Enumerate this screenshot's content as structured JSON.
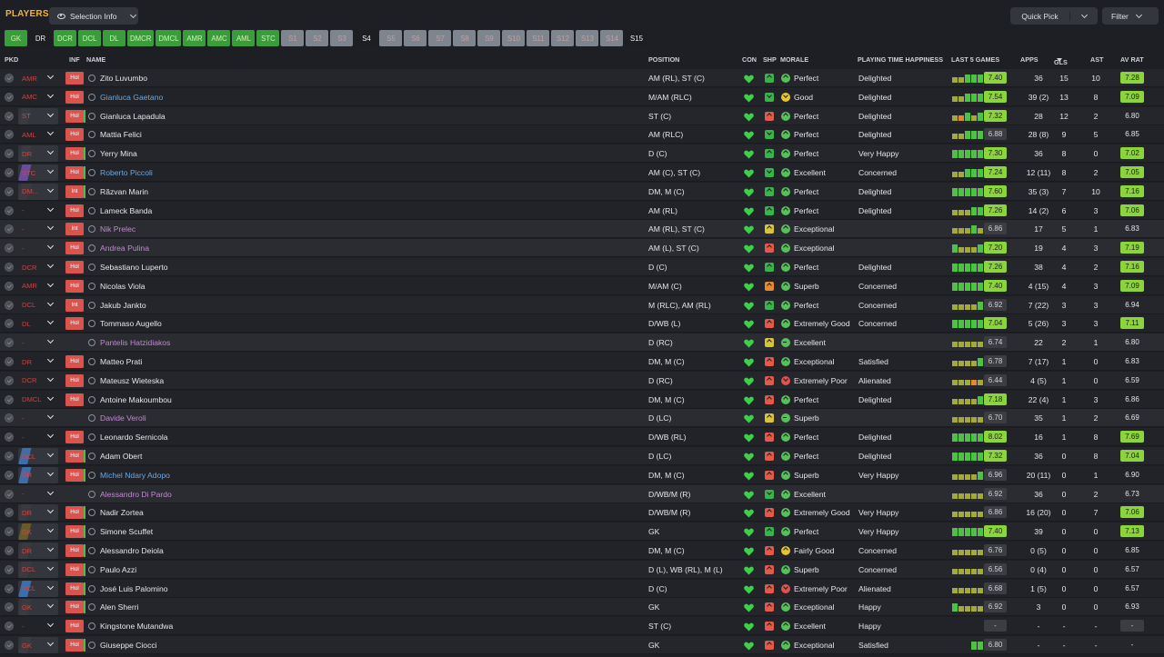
{
  "header": {
    "title": "PLAYERS",
    "selection_label": "Selection Info",
    "quickpick_label": "Quick Pick",
    "filter_label": "Filter"
  },
  "positions": [
    {
      "label": "GK",
      "style": "g"
    },
    {
      "label": "DR",
      "style": "k"
    },
    {
      "label": "DCR",
      "style": "g"
    },
    {
      "label": "DCL",
      "style": "g"
    },
    {
      "label": "DL",
      "style": "g"
    },
    {
      "label": "DMCR",
      "style": "g"
    },
    {
      "label": "DMCL",
      "style": "g"
    },
    {
      "label": "AMR",
      "style": "g"
    },
    {
      "label": "AMC",
      "style": "g"
    },
    {
      "label": "AML",
      "style": "g"
    },
    {
      "label": "STC",
      "style": "g"
    },
    {
      "label": "S1",
      "style": "s"
    },
    {
      "label": "S2",
      "style": "s"
    },
    {
      "label": "S3",
      "style": "s"
    },
    {
      "label": "S4",
      "style": "sel"
    },
    {
      "label": "S5",
      "style": "s"
    },
    {
      "label": "S6",
      "style": "s"
    },
    {
      "label": "S7",
      "style": "s"
    },
    {
      "label": "S8",
      "style": "s"
    },
    {
      "label": "S9",
      "style": "s"
    },
    {
      "label": "S10",
      "style": "s"
    },
    {
      "label": "S11",
      "style": "s"
    },
    {
      "label": "S12",
      "style": "s"
    },
    {
      "label": "S13",
      "style": "s"
    },
    {
      "label": "S14",
      "style": "s"
    },
    {
      "label": "S15",
      "style": "sel"
    }
  ],
  "columns": {
    "pkd": "PKD",
    "inf": "INF",
    "name": "NAME",
    "position": "POSITION",
    "con": "CON",
    "shp": "SHP",
    "morale": "MORALE",
    "pth": "PLAYING TIME HAPPINESS",
    "last5": "LAST 5 GAMES",
    "apps": "APPS",
    "gls": "GLS",
    "ast": "AST",
    "avrat": "AV RAT"
  },
  "colors": {
    "accent_title": "#f2b331",
    "green": "#8bd43b",
    "red_inf": "#d9534f",
    "link_name": "#6aa8e4",
    "loan_name": "#c288d3"
  },
  "players": [
    {
      "pos": "AMR",
      "pc": "",
      "inf": "Hol",
      "name": "Zito Luvumbo",
      "nt": "",
      "position": "AM (RL), ST (C)",
      "shp": "u",
      "mi": "up",
      "mc": "#55c15a",
      "morale": "Perfect",
      "pth": "Delighted",
      "form": "yyggg",
      "l5": "7.40",
      "l5g": true,
      "apps": "36",
      "gls": "15",
      "ast": "10",
      "av": "7.28",
      "av_s": "g"
    },
    {
      "pos": "AMC",
      "pc": "",
      "inf": "Hol",
      "name": "Gianluca Gaetano",
      "nt": "link",
      "position": "M/AM (RLC)",
      "shp": "d",
      "mi": "dn",
      "mc": "#e6c62f",
      "morale": "Good",
      "pth": "Delighted",
      "form": "yyggg",
      "l5": "7.54",
      "l5g": true,
      "apps": "39 (2)",
      "gls": "13",
      "ast": "8",
      "av": "7.09",
      "av_s": "g"
    },
    {
      "pos": "ST",
      "pc": "#3a3b40",
      "inf": "Hol",
      "name": "Gianluca Lapadula",
      "nt": "",
      "position": "ST (C)",
      "shp": "r",
      "mi": "up",
      "mc": "#55c15a",
      "morale": "Perfect",
      "pth": "Delighted",
      "form": "yogyg",
      "l5": "7.32",
      "l5g": true,
      "apps": "28",
      "gls": "12",
      "ast": "2",
      "av": "6.80",
      "av_s": "p"
    },
    {
      "pos": "AML",
      "pc": "",
      "inf": "Hol",
      "name": "Mattia Felici",
      "nt": "",
      "position": "AM (RLC)",
      "shp": "d",
      "mi": "up",
      "mc": "#55c15a",
      "morale": "Perfect",
      "pth": "Delighted",
      "form": "yyggg",
      "l5": "6.88",
      "l5g": false,
      "apps": "28 (8)",
      "gls": "9",
      "ast": "5",
      "av": "6.85",
      "av_s": "p"
    },
    {
      "pos": "DR",
      "pc": "#3a3b40",
      "inf": "Hol",
      "name": "Yerry Mina",
      "nt": "",
      "position": "D (C)",
      "shp": "u",
      "mi": "up",
      "mc": "#55c15a",
      "morale": "Perfect",
      "pth": "Very Happy",
      "form": "ggggg",
      "l5": "7.30",
      "l5g": true,
      "apps": "36",
      "gls": "8",
      "ast": "0",
      "av": "7.02",
      "av_s": "g"
    },
    {
      "pos": "STC",
      "pc": "#6a4c9c",
      "inf": "Hol",
      "name": "Roberto Piccoli",
      "nt": "link",
      "position": "AM (C), ST (C)",
      "shp": "d",
      "mi": "up",
      "mc": "#55c15a",
      "morale": "Excellent",
      "pth": "Concerned",
      "form": "yyggg",
      "l5": "7.24",
      "l5g": true,
      "apps": "12 (11)",
      "gls": "8",
      "ast": "2",
      "av": "7.05",
      "av_s": "g"
    },
    {
      "pos": "DM...",
      "pc": "#3a3b40",
      "inf": "Int",
      "name": "Răzvan Marin",
      "nt": "",
      "position": "DM, M (C)",
      "shp": "u",
      "mi": "up",
      "mc": "#55c15a",
      "morale": "Perfect",
      "pth": "Delighted",
      "form": "ggggg",
      "l5": "7.60",
      "l5g": true,
      "apps": "35 (3)",
      "gls": "7",
      "ast": "10",
      "av": "7.16",
      "av_s": "g"
    },
    {
      "pos": "-",
      "pc": "",
      "inf": "Hol",
      "name": "Lameck Banda",
      "nt": "",
      "position": "AM (RL)",
      "shp": "u",
      "mi": "up",
      "mc": "#55c15a",
      "morale": "Perfect",
      "pth": "Delighted",
      "form": "yyygg",
      "l5": "7.26",
      "l5g": true,
      "apps": "14 (2)",
      "gls": "6",
      "ast": "3",
      "av": "7.06",
      "av_s": "g"
    },
    {
      "pos": "-",
      "pc": "",
      "inf": "Int",
      "name": "Nik Prelec",
      "nt": "loan",
      "position": "AM (RL), ST (C)",
      "shp": "m",
      "mi": "up",
      "mc": "#55c15a",
      "morale": "Exceptional",
      "pth": "",
      "form": "yyygy",
      "l5": "6.86",
      "l5g": false,
      "apps": "17",
      "gls": "5",
      "ast": "1",
      "av": "6.83",
      "av_s": "p"
    },
    {
      "pos": "-",
      "pc": "",
      "inf": "Hol",
      "name": "Andrea Pulina",
      "nt": "loan",
      "position": "AM (L), ST (C)",
      "shp": "r",
      "mi": "up",
      "mc": "#55c15a",
      "morale": "Exceptional",
      "pth": "",
      "form": "gyyyg",
      "l5": "7.20",
      "l5g": true,
      "apps": "19",
      "gls": "4",
      "ast": "3",
      "av": "7.19",
      "av_s": "g"
    },
    {
      "pos": "DCR",
      "pc": "",
      "inf": "Hol",
      "name": "Sebastiano Luperto",
      "nt": "",
      "position": "D (C)",
      "shp": "u",
      "mi": "up",
      "mc": "#55c15a",
      "morale": "Perfect",
      "pth": "Delighted",
      "form": "ggggg",
      "l5": "7.26",
      "l5g": true,
      "apps": "38",
      "gls": "4",
      "ast": "2",
      "av": "7.16",
      "av_s": "g"
    },
    {
      "pos": "AMR",
      "pc": "",
      "inf": "Hol",
      "name": "Nicolas Viola",
      "nt": "",
      "position": "M/AM (C)",
      "shp": "o",
      "mi": "up",
      "mc": "#55c15a",
      "morale": "Superb",
      "pth": "Concerned",
      "form": "ggggg",
      "l5": "7.40",
      "l5g": true,
      "apps": "4 (15)",
      "gls": "4",
      "ast": "3",
      "av": "7.09",
      "av_s": "g"
    },
    {
      "pos": "DCL",
      "pc": "",
      "inf": "Int",
      "name": "Jakub Jankto",
      "nt": "",
      "position": "M (RLC), AM (RL)",
      "shp": "u",
      "mi": "up",
      "mc": "#55c15a",
      "morale": "Perfect",
      "pth": "Concerned",
      "form": "yyyyg",
      "l5": "6.92",
      "l5g": false,
      "apps": "7 (22)",
      "gls": "3",
      "ast": "3",
      "av": "6.94",
      "av_s": "p"
    },
    {
      "pos": "DL",
      "pc": "",
      "inf": "Hol",
      "name": "Tommaso Augello",
      "nt": "",
      "position": "D/WB (L)",
      "shp": "r",
      "mi": "up",
      "mc": "#55c15a",
      "morale": "Extremely Good",
      "pth": "Concerned",
      "form": "ggggg",
      "l5": "7.04",
      "l5g": true,
      "apps": "5 (26)",
      "gls": "3",
      "ast": "3",
      "av": "7.11",
      "av_s": "g"
    },
    {
      "pos": "-",
      "pc": "",
      "inf": "",
      "name": "Pantelis Hatzidiakos",
      "nt": "loan",
      "position": "D (RC)",
      "shp": "m",
      "mi": "mid",
      "mc": "#55c15a",
      "morale": "Excellent",
      "pth": "",
      "form": "yyyyy",
      "l5": "6.74",
      "l5g": false,
      "apps": "22",
      "gls": "2",
      "ast": "1",
      "av": "6.80",
      "av_s": "p"
    },
    {
      "pos": "DR",
      "pc": "",
      "inf": "Hol",
      "name": "Matteo Prati",
      "nt": "",
      "position": "DM, M (C)",
      "shp": "r",
      "mi": "up",
      "mc": "#55c15a",
      "morale": "Exceptional",
      "pth": "Satisfied",
      "form": "yyyyg",
      "l5": "6.78",
      "l5g": false,
      "apps": "7 (17)",
      "gls": "1",
      "ast": "0",
      "av": "6.83",
      "av_s": "p"
    },
    {
      "pos": "DCR",
      "pc": "",
      "inf": "Hol",
      "name": "Mateusz Wieteska",
      "nt": "",
      "position": "D (RC)",
      "shp": "r",
      "mi": "dn",
      "mc": "#e05252",
      "morale": "Extremely Poor",
      "pth": "Alienated",
      "form": "yyyoy",
      "l5": "6.44",
      "l5g": false,
      "apps": "4 (5)",
      "gls": "1",
      "ast": "0",
      "av": "6.59",
      "av_s": "p"
    },
    {
      "pos": "DMCL",
      "pc": "",
      "inf": "Hol",
      "name": "Antoine Makoumbou",
      "nt": "",
      "position": "DM, M (C)",
      "shp": "r",
      "mi": "up",
      "mc": "#55c15a",
      "morale": "Perfect",
      "pth": "Delighted",
      "form": "yyyyg",
      "l5": "7.18",
      "l5g": true,
      "apps": "22 (4)",
      "gls": "1",
      "ast": "3",
      "av": "6.86",
      "av_s": "p"
    },
    {
      "pos": "-",
      "pc": "",
      "inf": "",
      "name": "Davide Veroli",
      "nt": "loan",
      "position": "D (LC)",
      "shp": "m",
      "mi": "mid",
      "mc": "#55c15a",
      "morale": "Superb",
      "pth": "",
      "form": "yyyyy",
      "l5": "6.70",
      "l5g": false,
      "apps": "35",
      "gls": "1",
      "ast": "2",
      "av": "6.69",
      "av_s": "p"
    },
    {
      "pos": "-",
      "pc": "",
      "inf": "Hol",
      "name": "Leonardo Sernicola",
      "nt": "",
      "position": "D/WB (RL)",
      "shp": "r",
      "mi": "up",
      "mc": "#55c15a",
      "morale": "Perfect",
      "pth": "Delighted",
      "form": "ggggg",
      "l5": "8.02",
      "l5g": true,
      "apps": "16",
      "gls": "1",
      "ast": "8",
      "av": "7.69",
      "av_s": "g"
    },
    {
      "pos": "DCL",
      "pc": "#3c6eae",
      "inf": "Hol",
      "name": "Adam Obert",
      "nt": "",
      "position": "D (LC)",
      "shp": "r",
      "mi": "up",
      "mc": "#55c15a",
      "morale": "Perfect",
      "pth": "Delighted",
      "form": "ggggg",
      "l5": "7.32",
      "l5g": true,
      "apps": "36",
      "gls": "0",
      "ast": "8",
      "av": "7.04",
      "av_s": "g"
    },
    {
      "pos": "DR",
      "pc": "#3c6eae",
      "inf": "Hol",
      "name": "Michel Ndary Adopo",
      "nt": "link",
      "position": "DM, M (C)",
      "shp": "r",
      "mi": "up",
      "mc": "#55c15a",
      "morale": "Superb",
      "pth": "Very Happy",
      "form": "yyyyg",
      "l5": "6.96",
      "l5g": false,
      "apps": "20 (11)",
      "gls": "0",
      "ast": "1",
      "av": "6.90",
      "av_s": "p"
    },
    {
      "pos": "-",
      "pc": "",
      "inf": "",
      "name": "Alessandro Di Pardo",
      "nt": "loan",
      "position": "D/WB/M (R)",
      "shp": "d",
      "mi": "up",
      "mc": "#55c15a",
      "morale": "Excellent",
      "pth": "",
      "form": "yyyyy",
      "l5": "6.92",
      "l5g": false,
      "apps": "36",
      "gls": "0",
      "ast": "2",
      "av": "6.73",
      "av_s": "p"
    },
    {
      "pos": "DR",
      "pc": "#3a3b40",
      "inf": "Hol",
      "name": "Nadir Zortea",
      "nt": "",
      "position": "D/WB/M (R)",
      "shp": "r",
      "mi": "up",
      "mc": "#55c15a",
      "morale": "Extremely Good",
      "pth": "Very Happy",
      "form": "yyyyy",
      "l5": "6.86",
      "l5g": false,
      "apps": "16 (20)",
      "gls": "0",
      "ast": "7",
      "av": "7.06",
      "av_s": "g"
    },
    {
      "pos": "GK",
      "pc": "#6a5a2a",
      "inf": "Hol",
      "name": "Simone Scuffet",
      "nt": "",
      "position": "GK",
      "shp": "u",
      "mi": "up",
      "mc": "#55c15a",
      "morale": "Perfect",
      "pth": "Very Happy",
      "form": "ggggg",
      "l5": "7.40",
      "l5g": true,
      "apps": "39",
      "gls": "0",
      "ast": "0",
      "av": "7.13",
      "av_s": "g"
    },
    {
      "pos": "DR",
      "pc": "#3a3b40",
      "inf": "Hol",
      "name": "Alessandro Deiola",
      "nt": "",
      "position": "DM, M (C)",
      "shp": "r",
      "mi": "up",
      "mc": "#e6c62f",
      "morale": "Fairly Good",
      "pth": "Concerned",
      "form": "yyyyy",
      "l5": "6.76",
      "l5g": false,
      "apps": "0 (5)",
      "gls": "0",
      "ast": "0",
      "av": "6.85",
      "av_s": "p"
    },
    {
      "pos": "DCL",
      "pc": "#3a3b40",
      "inf": "Hol",
      "name": "Paulo Azzi",
      "nt": "",
      "position": "D (L), WB (RL), M (L)",
      "shp": "r",
      "mi": "up",
      "mc": "#55c15a",
      "morale": "Superb",
      "pth": "Concerned",
      "form": "yyyyy",
      "l5": "6.56",
      "l5g": false,
      "apps": "0 (4)",
      "gls": "0",
      "ast": "0",
      "av": "6.57",
      "av_s": "p"
    },
    {
      "pos": "DCL",
      "pc": "#3c6eae",
      "inf": "Hol",
      "name": "José Luis Palomino",
      "nt": "",
      "position": "D (C)",
      "shp": "r",
      "mi": "dn",
      "mc": "#e05252",
      "morale": "Extremely Poor",
      "pth": "Alienated",
      "form": "yyyyy",
      "l5": "6.68",
      "l5g": false,
      "apps": "1 (5)",
      "gls": "0",
      "ast": "0",
      "av": "6.57",
      "av_s": "p"
    },
    {
      "pos": "GK",
      "pc": "#3a3b40",
      "inf": "Hol",
      "name": "Alen Sherri",
      "nt": "",
      "position": "GK",
      "shp": "r",
      "mi": "up",
      "mc": "#55c15a",
      "morale": "Exceptional",
      "pth": "Happy",
      "form": "gyyyy",
      "l5": "6.92",
      "l5g": false,
      "apps": "3",
      "gls": "0",
      "ast": "0",
      "av": "6.93",
      "av_s": "p"
    },
    {
      "pos": "-",
      "pc": "",
      "inf": "Hol",
      "name": "Kingstone Mutandwa",
      "nt": "",
      "position": "ST (C)",
      "shp": "r",
      "mi": "up",
      "mc": "#55c15a",
      "morale": "Excellent",
      "pth": "Happy",
      "form": "",
      "l5": "-",
      "l5g": false,
      "apps": "-",
      "gls": "-",
      "ast": "-",
      "av": "-",
      "av_s": "x"
    },
    {
      "pos": "GK",
      "pc": "#3a3b40",
      "inf": "Hol",
      "name": "Giuseppe Ciocci",
      "nt": "",
      "position": "GK",
      "shp": "r",
      "mi": "up",
      "mc": "#55c15a",
      "morale": "Exceptional",
      "pth": "Satisfied",
      "form": "gg",
      "l5": "6.80",
      "l5g": false,
      "apps": "-",
      "gls": "-",
      "ast": "-",
      "av": "-",
      "av_s": "p"
    }
  ]
}
